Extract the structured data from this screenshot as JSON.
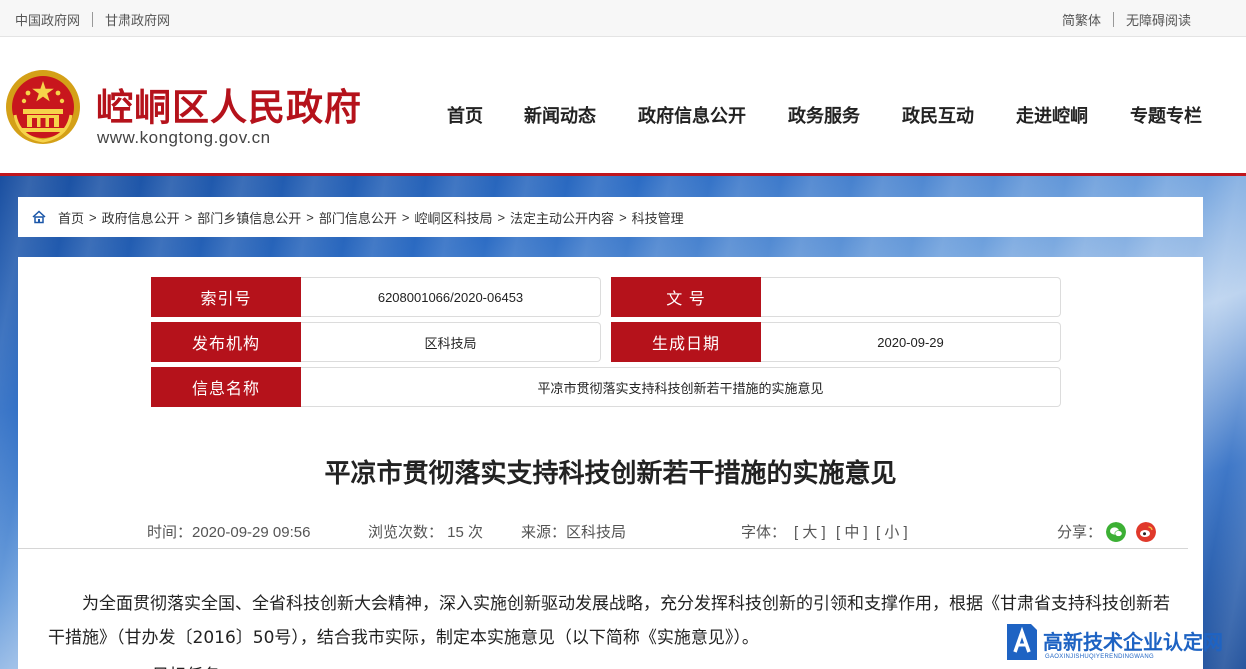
{
  "topbar": {
    "left_links": [
      "中国政府网",
      "甘肃政府网"
    ],
    "right_links": [
      "简繁体",
      "无障碍阅读"
    ]
  },
  "header": {
    "site_name": "崆峒区人民政府",
    "site_url": "www.kongtong.gov.cn",
    "emblem_icon": "national-emblem-icon",
    "nav": [
      "首页",
      "新闻动态",
      "政府信息公开",
      "政务服务",
      "政民互动",
      "走进崆峒",
      "专题专栏"
    ]
  },
  "breadcrumb": {
    "home_icon": "home-icon",
    "items": [
      "首页",
      "政府信息公开",
      "部门乡镇信息公开",
      "部门信息公开",
      "崆峒区科技局",
      "法定主动公开内容",
      "科技管理"
    ],
    "separator": ">"
  },
  "meta": {
    "index_label": "索引号",
    "index_value": "6208001066/2020-06453",
    "doc_no_label": "文 号",
    "doc_no_value": "",
    "publisher_label": "发布机构",
    "publisher_value": "区科技局",
    "date_label": "生成日期",
    "date_value": "2020-09-29",
    "name_label": "信息名称",
    "name_value": "平凉市贯彻落实支持科技创新若干措施的实施意见"
  },
  "article": {
    "title": "平凉市贯彻落实支持科技创新若干措施的实施意见",
    "time": "时间：2020-09-29 09:56",
    "views": "浏览次数： 15 次",
    "source": "来源：区科技局",
    "font_label": "字体：",
    "font_large": "[ 大 ]",
    "font_medium": "[ 中 ]",
    "font_small": "[ 小 ]",
    "share_label": "分享：",
    "share_icons": [
      "wechat-icon",
      "weibo-icon"
    ],
    "paragraph1": "为全面贯彻落实全国、全省科技创新大会精神，深入实施创新驱动发展战略，充分发挥科技创新的引领和支撑作用，根据《甘肃省支持科技创新若干措施》（甘办发〔2016〕50号），结合我市实际，制定本实施意见（以下简称《实施意见》）。",
    "paragraph2": "一、目标任务"
  },
  "watermark": {
    "text": "高新技术企业认定网",
    "sub": "GAOXINJISHUQIYERENDINGWANG"
  },
  "colors": {
    "brand_red": "#b5121b",
    "link_blue": "#1a56a8",
    "watermark_blue": "#1e63c3"
  }
}
